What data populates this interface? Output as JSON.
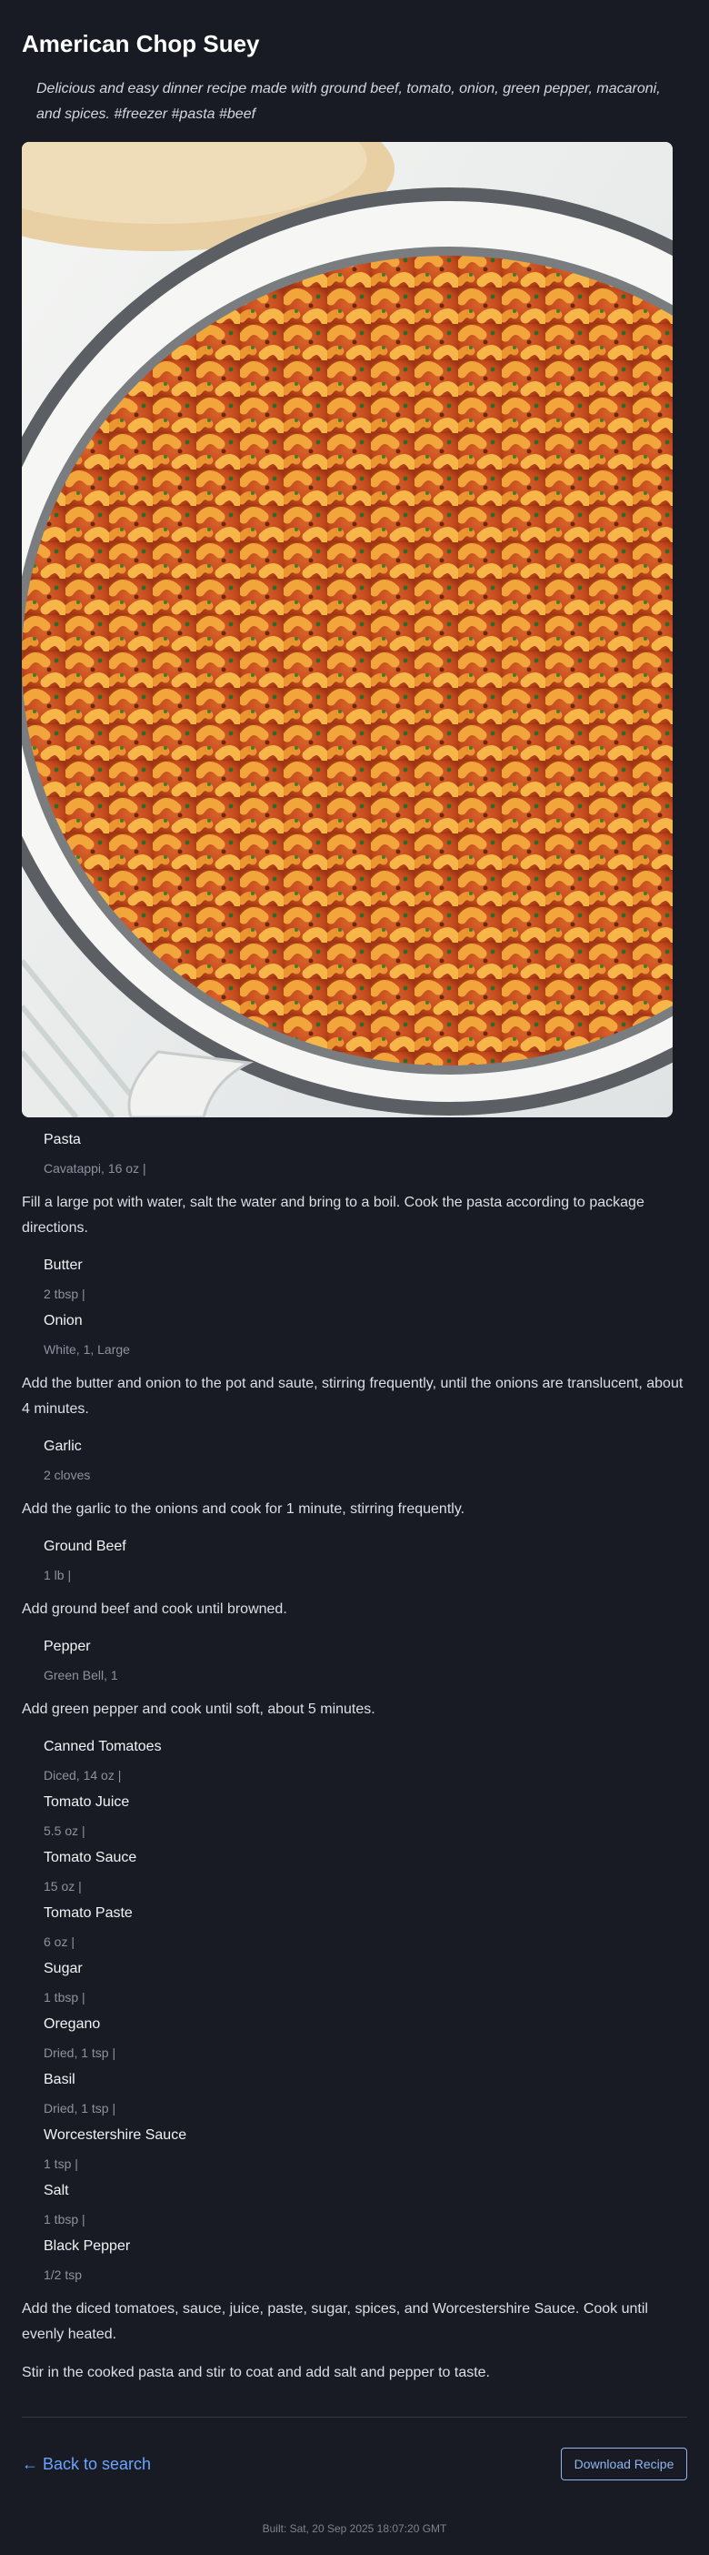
{
  "recipe": {
    "title": "American Chop Suey",
    "description": "Delicious and easy dinner recipe made with ground beef, tomato, onion, green pepper, macaroni, and spices. #freezer #pasta #beef",
    "image_icon": "pasta-dish-photo"
  },
  "sections": [
    {
      "ingredients": [
        {
          "name": "Pasta",
          "detail": "Cavatappi, 16 oz |"
        }
      ],
      "step": "Fill a large pot with water, salt the water and bring to a boil. Cook the pasta according to package directions."
    },
    {
      "ingredients": [
        {
          "name": "Butter",
          "detail": "2 tbsp |"
        },
        {
          "name": "Onion",
          "detail": "White, 1, Large"
        }
      ],
      "step": "Add the butter and onion to the pot and saute, stirring frequently, until the onions are translucent, about 4 minutes."
    },
    {
      "ingredients": [
        {
          "name": "Garlic",
          "detail": "2 cloves"
        }
      ],
      "step": "Add the garlic to the onions and cook for 1 minute, stirring frequently."
    },
    {
      "ingredients": [
        {
          "name": "Ground Beef",
          "detail": "1 lb |"
        }
      ],
      "step": "Add ground beef and cook until browned."
    },
    {
      "ingredients": [
        {
          "name": "Pepper",
          "detail": "Green Bell, 1"
        }
      ],
      "step": "Add green pepper and cook until soft, about 5 minutes."
    },
    {
      "ingredients": [
        {
          "name": "Canned Tomatoes",
          "detail": "Diced, 14 oz |"
        },
        {
          "name": "Tomato Juice",
          "detail": "5.5 oz |"
        },
        {
          "name": "Tomato Sauce",
          "detail": "15 oz |"
        },
        {
          "name": "Tomato Paste",
          "detail": "6 oz |"
        },
        {
          "name": "Sugar",
          "detail": "1 tbsp |"
        },
        {
          "name": "Oregano",
          "detail": "Dried, 1 tsp |"
        },
        {
          "name": "Basil",
          "detail": "Dried, 1 tsp |"
        },
        {
          "name": "Worcestershire Sauce",
          "detail": "1 tsp |"
        },
        {
          "name": "Salt",
          "detail": "1 tbsp |"
        },
        {
          "name": "Black Pepper",
          "detail": "1/2 tsp"
        }
      ],
      "step": "Add the diced tomatoes, sauce, juice, paste, sugar, spices, and Worcestershire Sauce. Cook until evenly heated."
    },
    {
      "ingredients": [],
      "step": "Stir in the cooked pasta and stir to coat and add salt and pepper to taste."
    }
  ],
  "footer": {
    "back_label": "← Back to search",
    "download_label": "Download Recipe",
    "built": "Built: Sat, 20 Sep 2025 18:07:20 GMT"
  },
  "colors": {
    "background": "#181b23",
    "link": "#6ba4ff",
    "button": "#8fb4f0",
    "muted": "#8d929c"
  }
}
